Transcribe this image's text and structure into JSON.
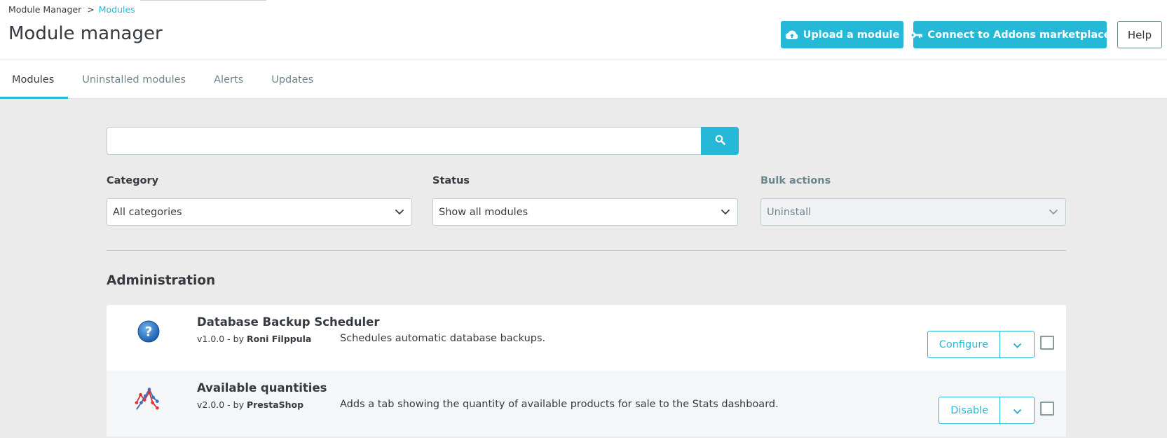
{
  "breadcrumb": {
    "parent": "Module Manager",
    "separator": ">",
    "current": "Modules"
  },
  "page_title": "Module manager",
  "toolbar": {
    "upload_label": "Upload a module",
    "connect_label": "Connect to Addons marketplace",
    "help_label": "Help"
  },
  "tabs": [
    {
      "label": "Modules",
      "active": true
    },
    {
      "label": "Uninstalled modules",
      "active": false
    },
    {
      "label": "Alerts",
      "active": false
    },
    {
      "label": "Updates",
      "active": false
    }
  ],
  "search": {
    "value": "",
    "icon": "search-icon"
  },
  "filters": {
    "category": {
      "label": "Category",
      "value": "All categories"
    },
    "status": {
      "label": "Status",
      "value": "Show all modules"
    },
    "bulk": {
      "label": "Bulk actions",
      "value": "Uninstall",
      "disabled": true
    }
  },
  "section": {
    "title": "Administration"
  },
  "modules": [
    {
      "name": "Database Backup Scheduler",
      "version": "v1.0.0 - by",
      "author": "Roni Filppula",
      "description": "Schedules automatic database backups.",
      "action": "Configure",
      "icon": "question-icon"
    },
    {
      "name": "Available quantities",
      "version": "v2.0.0 - by",
      "author": "PrestaShop",
      "description": "Adds a tab showing the quantity of available products for sale to the Stats dashboard.",
      "action": "Disable",
      "icon": "stats-chart-icon"
    }
  ],
  "colors": {
    "primary": "#25b9d7",
    "text": "#363a41",
    "muted": "#6c868e",
    "background": "#ebebeb"
  }
}
